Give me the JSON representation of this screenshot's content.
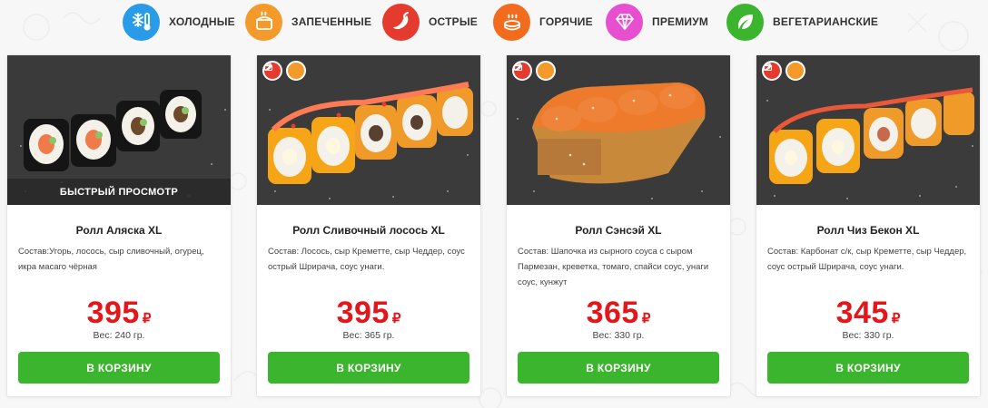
{
  "categories": [
    {
      "label": "ХОЛОДНЫЕ",
      "icon": "snowflake-thermometer-icon",
      "color": "#2a9be6"
    },
    {
      "label": "ЗАПЕЧЕННЫЕ",
      "icon": "baked-roll-icon",
      "color": "#f39a2b"
    },
    {
      "label": "ОСТРЫЕ",
      "icon": "chili-pepper-icon",
      "color": "#e53b2f"
    },
    {
      "label": "ГОРЯЧИЕ",
      "icon": "hot-roll-icon",
      "color": "#f36b1c"
    },
    {
      "label": "ПРЕМИУМ",
      "icon": "diamond-icon",
      "color": "#e64fd0"
    },
    {
      "label": "ВЕГЕТАРИАНСКИЕ",
      "icon": "leaf-icon",
      "color": "#3cb52e"
    }
  ],
  "products": [
    {
      "name": "Ролл Аляска XL",
      "description": "Состав:Угорь, лосось, сыр сливочный, огурец, икра масаго чёрная",
      "price": "395",
      "currency": "₽",
      "weight": "Вес: 240 гр.",
      "quick_view": "БЫСТРЫЙ ПРОСМОТР",
      "button": "В КОРЗИНУ",
      "badges": []
    },
    {
      "name": "Ролл Сливочный лосось XL",
      "description": "Состав: Лосось, сыр Креметте, сыр Чеддер, соус острый Шрирача, соус унаги.",
      "price": "395",
      "currency": "₽",
      "weight": "Вес: 365 гр.",
      "button": "В КОРЗИНУ",
      "badges": [
        "chili-pepper-icon",
        "baked-roll-icon"
      ]
    },
    {
      "name": "Ролл Сэнсэй XL",
      "description": "Состав: Шапочка из сырного соуса с сыром Пармезан, креветка, томаго, спайси соус, унаги соус, кунжут",
      "price": "365",
      "currency": "₽",
      "weight": "Вес: 330 гр.",
      "button": "В КОРЗИНУ",
      "badges": [
        "chili-pepper-icon",
        "baked-roll-icon"
      ]
    },
    {
      "name": "Ролл Чиз Бекон XL",
      "description": "Состав: Карбонат с/к, сыр Креметте, сыр Чеддер, соус острый Шрирача, соус унаги.",
      "price": "345",
      "currency": "₽",
      "weight": "Вес: 330 гр.",
      "button": "В КОРЗИНУ",
      "badges": [
        "chili-pepper-icon",
        "baked-roll-icon"
      ]
    }
  ]
}
